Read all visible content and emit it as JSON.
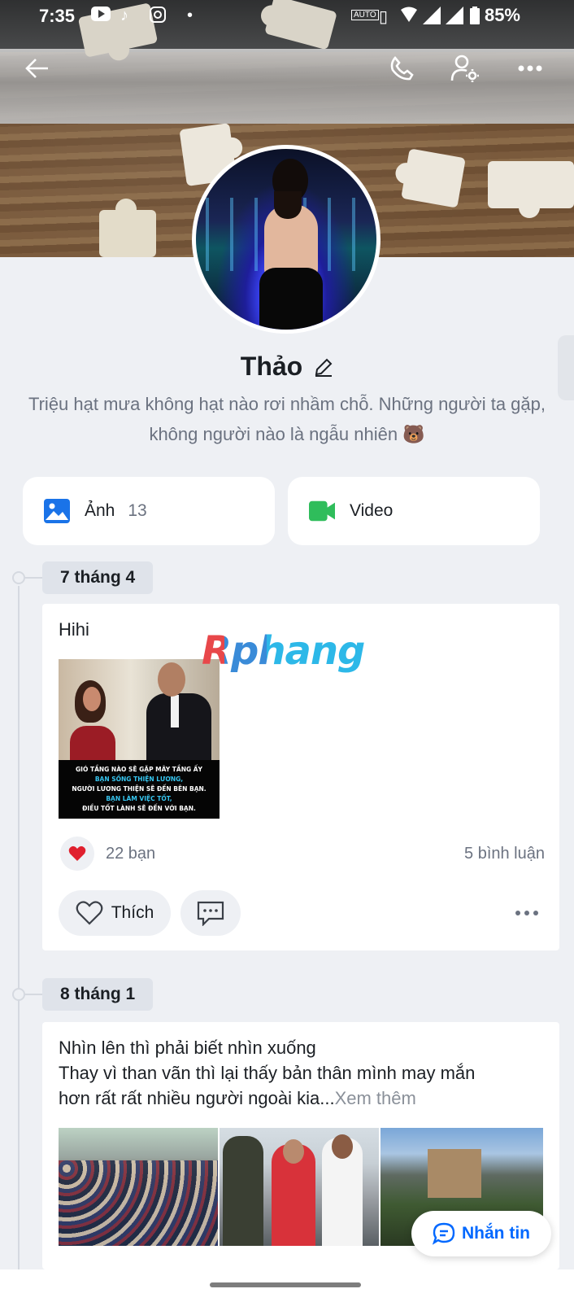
{
  "status_bar": {
    "time": "7:35",
    "battery": "85%"
  },
  "profile": {
    "name": "Thảo",
    "bio": "Triệu hạt mưa không hạt nào rơi nhầm chỗ. Những người ta gặp, không người nào là ngẫu nhiên 🐻"
  },
  "media": {
    "photos_label": "Ảnh",
    "photos_count": "13",
    "video_label": "Video"
  },
  "timeline": [
    {
      "date": "7 tháng 4",
      "text": "Hihi",
      "image_caption": [
        "GIÓ TẦNG NÀO SẼ GẶP MÂY TẦNG ẤY",
        "BẠN SỐNG THIỆN LƯƠNG,",
        "NGƯỜI LƯƠNG THIỆN SẼ ĐẾN BÊN BẠN.",
        "BẠN LÀM VIỆC TỐT,",
        "ĐIỀU TỐT LÀNH SẼ ĐẾN VỚI BẠN."
      ],
      "likes": "22 bạn",
      "comments": "5 bình luận",
      "like_label": "Thích"
    },
    {
      "date": "8 tháng 1",
      "text_line1": "Nhìn lên thì phải biết nhìn xuống",
      "text_line2": "Thay vì than vãn thì lại thấy bản thân mình may mắn",
      "text_line3": "hơn rất rất nhiều người ngoài kia...",
      "see_more": "Xem thêm"
    }
  ],
  "fab": {
    "label": "Nhắn tin"
  },
  "watermark": "Rphang",
  "colors": {
    "accent": "#0068ff",
    "photo_icon": "#1a73e8",
    "video_icon": "#2fbd5b",
    "heart": "#e0202e"
  }
}
